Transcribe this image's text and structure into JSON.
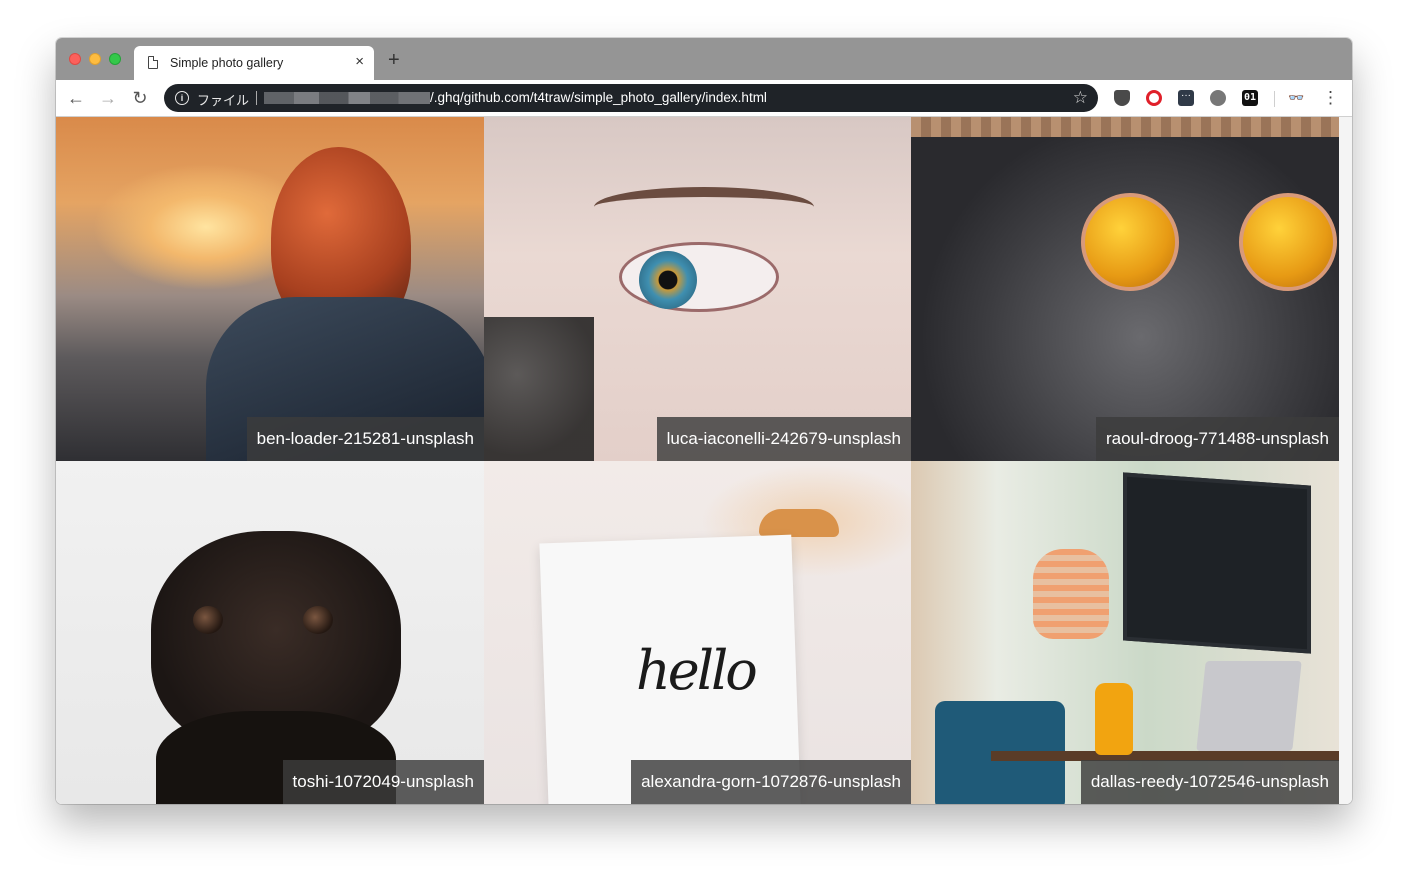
{
  "browser": {
    "tab": {
      "title": "Simple photo gallery",
      "close_label": "×"
    },
    "new_tab_label": "+",
    "nav": {
      "back": "←",
      "forward": "→",
      "reload": "↻"
    },
    "address": {
      "info_icon": "i",
      "scheme_label": "ファイル",
      "url_text": "/.ghq/github.com/t4traw/simple_photo_gallery/index.html",
      "bookmark_icon": "☆"
    },
    "extensions": [
      {
        "name": "pocket-icon",
        "glyph": ""
      },
      {
        "name": "opera-icon",
        "glyph": ""
      },
      {
        "name": "dots-extension-icon",
        "glyph": "···"
      },
      {
        "name": "gauge-extension-icon",
        "glyph": ""
      },
      {
        "name": "binary-extension-icon",
        "glyph": "01"
      },
      {
        "name": "incognito-spy-icon",
        "glyph": "👓"
      }
    ],
    "menu_icon": "⋮"
  },
  "gallery": {
    "photos": [
      {
        "caption": "ben-loader-215281-unsplash"
      },
      {
        "caption": "luca-iaconelli-242679-unsplash"
      },
      {
        "caption": "raoul-droog-771488-unsplash"
      },
      {
        "caption": "toshi-1072049-unsplash"
      },
      {
        "caption": "alexandra-gorn-1072876-unsplash"
      },
      {
        "caption": "dallas-reedy-1072546-unsplash"
      }
    ],
    "hello_text": "hello"
  },
  "colors": {
    "titlebar": "#959595",
    "omnibox": "#1f2328",
    "caption_bg": "#3c3c3c"
  }
}
